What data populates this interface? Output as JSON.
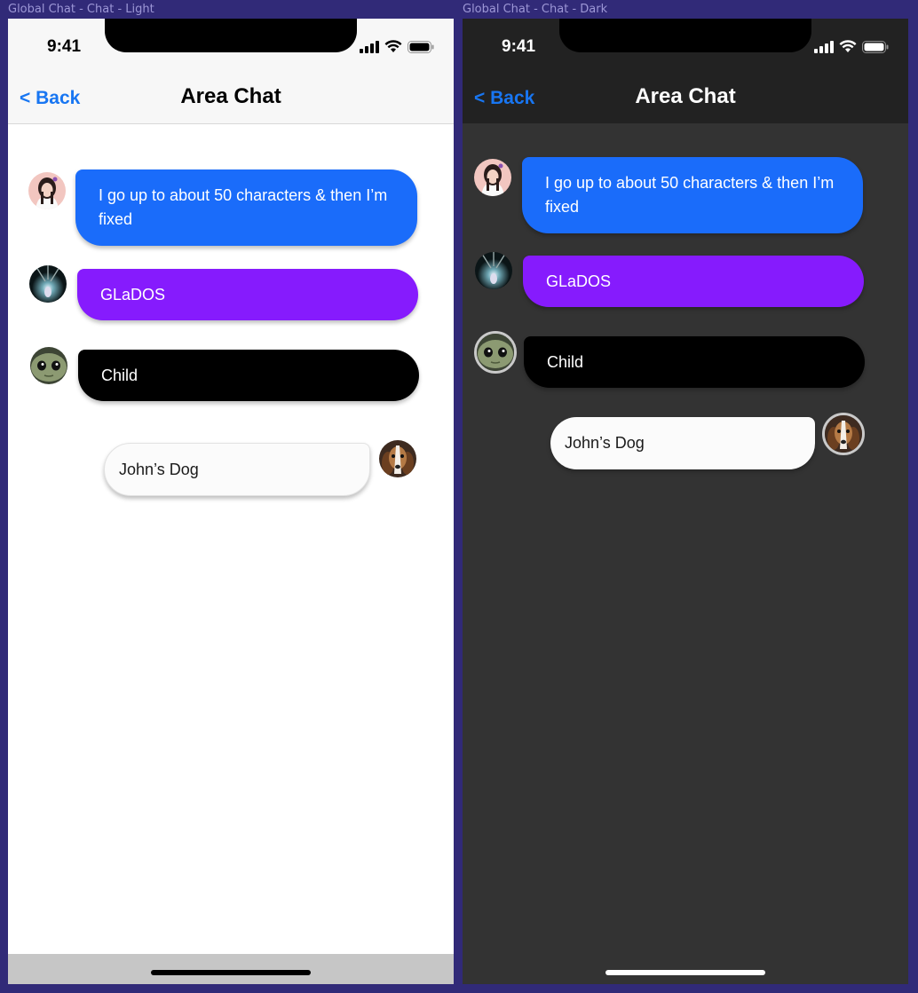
{
  "frames": {
    "light_label": "Global Chat - Chat - Light",
    "dark_label": "Global Chat - Chat - Dark"
  },
  "status_bar": {
    "time": "9:41"
  },
  "navbar": {
    "back_label": "< Back",
    "title": "Area Chat"
  },
  "messages": [
    {
      "text": "I go up to about 50 characters & then I’m fixed",
      "color": "#1a6cfa",
      "avatar": "girl-avatar"
    },
    {
      "text": "GLaDOS",
      "color": "#861bfd",
      "avatar": "glados-avatar"
    },
    {
      "text": "Child",
      "color": "#000000",
      "avatar": "child-avatar"
    },
    {
      "text": "John’s Dog",
      "color": "#fbfbfb",
      "avatar": "dog-avatar"
    }
  ],
  "colors": {
    "accent": "#1876f2",
    "light_bg": "#ffffff",
    "dark_bg": "#333333",
    "dark_nav": "#222222",
    "frame_bg": "#312a78"
  }
}
